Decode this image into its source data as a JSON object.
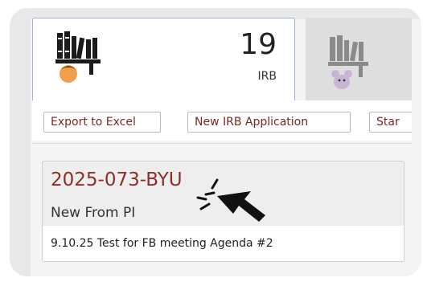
{
  "tiles": [
    {
      "count": "19",
      "label": "IRB",
      "icon": "books-user-icon",
      "selected": true
    },
    {
      "icon": "books-mouse-icon",
      "selected": false
    }
  ],
  "toolbar": {
    "export_label": "Export to Excel",
    "new_app_label": "New IRB Application",
    "start_label": "Star"
  },
  "card": {
    "id": "2025-073-BYU",
    "status": "New From PI",
    "description": "9.10.25 Test for FB meeting Agenda #2"
  },
  "colors": {
    "accent": "#8c2f28",
    "button_text": "#7a2621",
    "selected_border": "#9db4d6",
    "frame": "#e9e9e9"
  },
  "cursor": {
    "icon": "click-pointer-icon"
  }
}
